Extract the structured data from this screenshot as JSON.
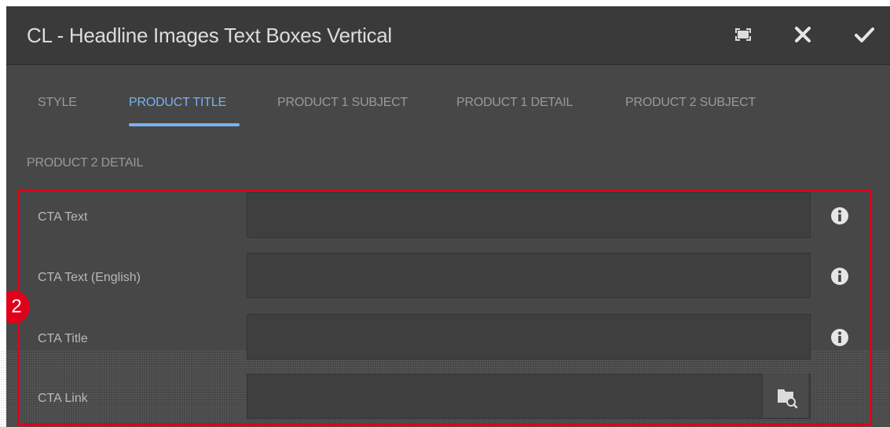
{
  "dialog": {
    "title": "CL - Headline Images Text Boxes Vertical"
  },
  "tabs": [
    {
      "label": "STYLE",
      "active": false
    },
    {
      "label": "PRODUCT TITLE",
      "active": true
    },
    {
      "label": "PRODUCT 1 SUBJECT",
      "active": false
    },
    {
      "label": "PRODUCT 1 DETAIL",
      "active": false
    },
    {
      "label": "PRODUCT 2 SUBJECT",
      "active": false
    },
    {
      "label": "PRODUCT 2 DETAIL",
      "active": false
    }
  ],
  "fields": [
    {
      "label": "CTA Text",
      "value": ""
    },
    {
      "label": "CTA Text (English)",
      "value": ""
    },
    {
      "label": "CTA Title",
      "value": ""
    },
    {
      "label": "CTA Link",
      "value": ""
    }
  ],
  "annotation": {
    "badge": "2"
  },
  "icons": {
    "fullscreen": "fullscreen-icon",
    "close": "close-icon",
    "confirm": "checkmark-icon",
    "info": "info-icon",
    "browse": "folder-search-icon"
  },
  "colors": {
    "dialog_bg": "#474747",
    "titlebar_bg": "#3a3a3a",
    "active_tab": "#7ab0f0",
    "highlight": "#e0001a"
  }
}
